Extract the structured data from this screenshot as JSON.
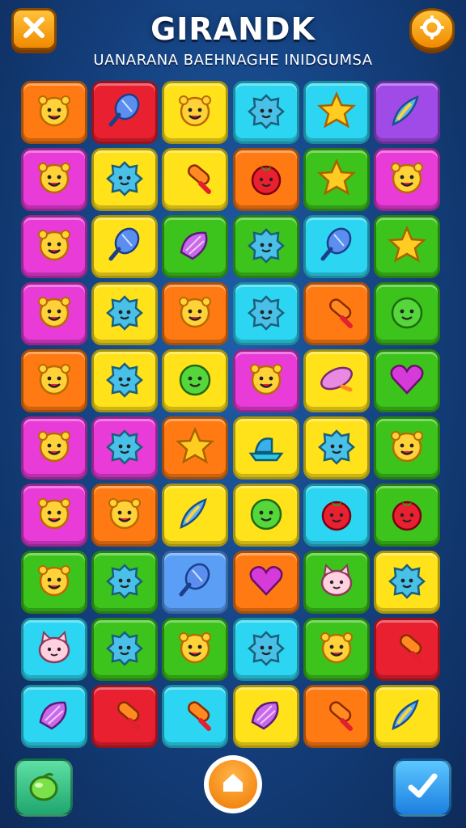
{
  "header": {
    "title": "GIRANDK",
    "subtitle": "UANARANA BAEHNAGHE INIDGUMSA",
    "close_icon": "close-icon",
    "settings_icon": "gear-icon"
  },
  "colors": {
    "orange": "#ff7a12",
    "red": "#e8202f",
    "yellow": "#ffe21a",
    "cyan": "#2cd6f2",
    "purple": "#a04be8",
    "magenta": "#e93bd8",
    "green": "#3cc41c",
    "blue": "#5a9ff5"
  },
  "board": {
    "rows": [
      [
        {
          "bg": "orange",
          "icon": "sun"
        },
        {
          "bg": "red",
          "icon": "feather"
        },
        {
          "bg": "yellow",
          "icon": "sun"
        },
        {
          "bg": "cyan",
          "icon": "blob"
        },
        {
          "bg": "cyan",
          "icon": "star"
        },
        {
          "bg": "purple",
          "icon": "rocket"
        }
      ],
      [
        {
          "bg": "magenta",
          "icon": "sun"
        },
        {
          "bg": "yellow",
          "icon": "blob"
        },
        {
          "bg": "yellow",
          "icon": "candy"
        },
        {
          "bg": "orange",
          "icon": "tomato"
        },
        {
          "bg": "green",
          "icon": "star"
        },
        {
          "bg": "magenta",
          "icon": "sun"
        }
      ],
      [
        {
          "bg": "magenta",
          "icon": "sun"
        },
        {
          "bg": "yellow",
          "icon": "feather"
        },
        {
          "bg": "green",
          "icon": "shell"
        },
        {
          "bg": "green",
          "icon": "blob"
        },
        {
          "bg": "cyan",
          "icon": "feather"
        },
        {
          "bg": "green",
          "icon": "star"
        }
      ],
      [
        {
          "bg": "magenta",
          "icon": "sun"
        },
        {
          "bg": "yellow",
          "icon": "blob"
        },
        {
          "bg": "orange",
          "icon": "sun"
        },
        {
          "bg": "cyan",
          "icon": "blob"
        },
        {
          "bg": "orange",
          "icon": "candy"
        },
        {
          "bg": "green",
          "icon": "ball"
        }
      ],
      [
        {
          "bg": "orange",
          "icon": "sun"
        },
        {
          "bg": "yellow",
          "icon": "blob"
        },
        {
          "bg": "yellow",
          "icon": "ball"
        },
        {
          "bg": "magenta",
          "icon": "sun"
        },
        {
          "bg": "yellow",
          "icon": "pill"
        },
        {
          "bg": "green",
          "icon": "heart"
        }
      ],
      [
        {
          "bg": "magenta",
          "icon": "sun"
        },
        {
          "bg": "magenta",
          "icon": "blob"
        },
        {
          "bg": "orange",
          "icon": "star"
        },
        {
          "bg": "yellow",
          "icon": "boat"
        },
        {
          "bg": "yellow",
          "icon": "blob"
        },
        {
          "bg": "green",
          "icon": "sun"
        }
      ],
      [
        {
          "bg": "magenta",
          "icon": "sun"
        },
        {
          "bg": "orange",
          "icon": "sun"
        },
        {
          "bg": "yellow",
          "icon": "rocket"
        },
        {
          "bg": "yellow",
          "icon": "ball"
        },
        {
          "bg": "cyan",
          "icon": "tomato"
        },
        {
          "bg": "green",
          "icon": "tomato"
        }
      ],
      [
        {
          "bg": "green",
          "icon": "sun"
        },
        {
          "bg": "green",
          "icon": "blob"
        },
        {
          "bg": "blue",
          "icon": "feather"
        },
        {
          "bg": "orange",
          "icon": "heart"
        },
        {
          "bg": "green",
          "icon": "cat"
        },
        {
          "bg": "yellow",
          "icon": "blob"
        }
      ],
      [
        {
          "bg": "cyan",
          "icon": "cat"
        },
        {
          "bg": "green",
          "icon": "blob"
        },
        {
          "bg": "green",
          "icon": "sun"
        },
        {
          "bg": "cyan",
          "icon": "blob"
        },
        {
          "bg": "green",
          "icon": "sun"
        },
        {
          "bg": "red",
          "icon": "candy"
        }
      ],
      [
        {
          "bg": "cyan",
          "icon": "shell"
        },
        {
          "bg": "red",
          "icon": "candy"
        },
        {
          "bg": "cyan",
          "icon": "candy"
        },
        {
          "bg": "yellow",
          "icon": "shell"
        },
        {
          "bg": "orange",
          "icon": "candy"
        },
        {
          "bg": "yellow",
          "icon": "rocket"
        }
      ]
    ]
  },
  "footer": {
    "left_icon": "green-gem-icon",
    "center_icon": "home-icon",
    "right_icon": "check-icon"
  }
}
